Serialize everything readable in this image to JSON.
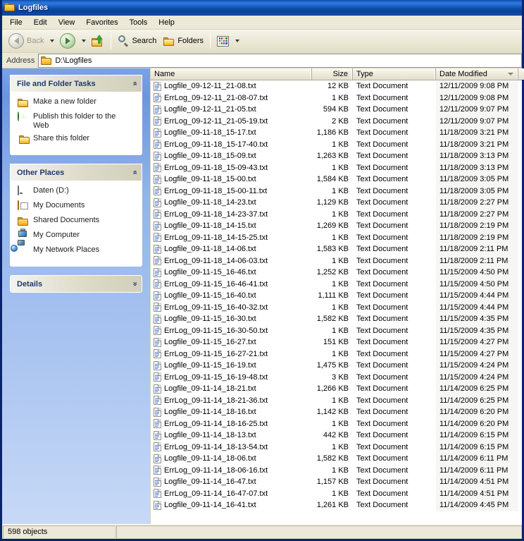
{
  "window": {
    "title": "Logfiles",
    "title_icon": "folder-icon"
  },
  "menubar": {
    "items": [
      {
        "label": "File"
      },
      {
        "label": "Edit"
      },
      {
        "label": "View"
      },
      {
        "label": "Favorites"
      },
      {
        "label": "Tools"
      },
      {
        "label": "Help"
      }
    ]
  },
  "toolbar": {
    "back_label": "Back",
    "back_icon": "arrow-left-icon",
    "back_dropdown_icon": "chevron-down-icon",
    "forward_icon": "arrow-right-icon",
    "forward_dropdown_icon": "chevron-down-icon",
    "up_icon": "up-folder-icon",
    "search_label": "Search",
    "search_icon": "magnifier-icon",
    "folders_label": "Folders",
    "folders_icon": "folder-open-icon",
    "views_icon": "views-icon",
    "views_dropdown_icon": "chevron-down-icon"
  },
  "address": {
    "label": "Address",
    "icon": "folder-icon",
    "value": "D:\\Logfiles"
  },
  "sidebar": {
    "panels": [
      {
        "title": "File and Folder Tasks",
        "chevron": "«",
        "chevron_state": "expanded",
        "links": [
          {
            "label": "Make a new folder",
            "icon": "new-folder-icon"
          },
          {
            "label": "Publish this folder to the Web",
            "icon": "publish-web-icon"
          },
          {
            "label": "Share this folder",
            "icon": "share-folder-icon"
          }
        ]
      },
      {
        "title": "Other Places",
        "chevron": "«",
        "chevron_state": "expanded",
        "links": [
          {
            "label": "Daten (D:)",
            "icon": "drive-icon"
          },
          {
            "label": "My Documents",
            "icon": "my-documents-icon"
          },
          {
            "label": "Shared Documents",
            "icon": "shared-documents-icon"
          },
          {
            "label": "My Computer",
            "icon": "my-computer-icon"
          },
          {
            "label": "My Network Places",
            "icon": "network-places-icon"
          }
        ]
      },
      {
        "title": "Details",
        "chevron": "»",
        "chevron_state": "collapsed",
        "links": []
      }
    ]
  },
  "filelist": {
    "columns": [
      {
        "key": "name",
        "label": "Name"
      },
      {
        "key": "size",
        "label": "Size"
      },
      {
        "key": "type",
        "label": "Type"
      },
      {
        "key": "date",
        "label": "Date Modified"
      }
    ],
    "sort_column": "Date Modified",
    "sort_direction": "descending",
    "sort_icon": "sort-descending-icon",
    "row_icon": "text-document-icon",
    "rows": [
      {
        "name": "Logfile_09-12-11_21-08.txt",
        "size": "12 KB",
        "type": "Text Document",
        "date": "12/11/2009 9:08 PM"
      },
      {
        "name": "ErrLog_09-12-11_21-08-07.txt",
        "size": "1 KB",
        "type": "Text Document",
        "date": "12/11/2009 9:08 PM"
      },
      {
        "name": "Logfile_09-12-11_21-05.txt",
        "size": "594 KB",
        "type": "Text Document",
        "date": "12/11/2009 9:07 PM"
      },
      {
        "name": "ErrLog_09-12-11_21-05-19.txt",
        "size": "2 KB",
        "type": "Text Document",
        "date": "12/11/2009 9:07 PM"
      },
      {
        "name": "Logfile_09-11-18_15-17.txt",
        "size": "1,186 KB",
        "type": "Text Document",
        "date": "11/18/2009 3:21 PM"
      },
      {
        "name": "ErrLog_09-11-18_15-17-40.txt",
        "size": "1 KB",
        "type": "Text Document",
        "date": "11/18/2009 3:21 PM"
      },
      {
        "name": "Logfile_09-11-18_15-09.txt",
        "size": "1,263 KB",
        "type": "Text Document",
        "date": "11/18/2009 3:13 PM"
      },
      {
        "name": "ErrLog_09-11-18_15-09-43.txt",
        "size": "1 KB",
        "type": "Text Document",
        "date": "11/18/2009 3:13 PM"
      },
      {
        "name": "Logfile_09-11-18_15-00.txt",
        "size": "1,584 KB",
        "type": "Text Document",
        "date": "11/18/2009 3:05 PM"
      },
      {
        "name": "ErrLog_09-11-18_15-00-11.txt",
        "size": "1 KB",
        "type": "Text Document",
        "date": "11/18/2009 3:05 PM"
      },
      {
        "name": "Logfile_09-11-18_14-23.txt",
        "size": "1,129 KB",
        "type": "Text Document",
        "date": "11/18/2009 2:27 PM"
      },
      {
        "name": "ErrLog_09-11-18_14-23-37.txt",
        "size": "1 KB",
        "type": "Text Document",
        "date": "11/18/2009 2:27 PM"
      },
      {
        "name": "Logfile_09-11-18_14-15.txt",
        "size": "1,269 KB",
        "type": "Text Document",
        "date": "11/18/2009 2:19 PM"
      },
      {
        "name": "ErrLog_09-11-18_14-15-25.txt",
        "size": "1 KB",
        "type": "Text Document",
        "date": "11/18/2009 2:19 PM"
      },
      {
        "name": "Logfile_09-11-18_14-06.txt",
        "size": "1,583 KB",
        "type": "Text Document",
        "date": "11/18/2009 2:11 PM"
      },
      {
        "name": "ErrLog_09-11-18_14-06-03.txt",
        "size": "1 KB",
        "type": "Text Document",
        "date": "11/18/2009 2:11 PM"
      },
      {
        "name": "Logfile_09-11-15_16-46.txt",
        "size": "1,252 KB",
        "type": "Text Document",
        "date": "11/15/2009 4:50 PM"
      },
      {
        "name": "ErrLog_09-11-15_16-46-41.txt",
        "size": "1 KB",
        "type": "Text Document",
        "date": "11/15/2009 4:50 PM"
      },
      {
        "name": "Logfile_09-11-15_16-40.txt",
        "size": "1,111 KB",
        "type": "Text Document",
        "date": "11/15/2009 4:44 PM"
      },
      {
        "name": "ErrLog_09-11-15_16-40-32.txt",
        "size": "1 KB",
        "type": "Text Document",
        "date": "11/15/2009 4:44 PM"
      },
      {
        "name": "Logfile_09-11-15_16-30.txt",
        "size": "1,582 KB",
        "type": "Text Document",
        "date": "11/15/2009 4:35 PM"
      },
      {
        "name": "ErrLog_09-11-15_16-30-50.txt",
        "size": "1 KB",
        "type": "Text Document",
        "date": "11/15/2009 4:35 PM"
      },
      {
        "name": "Logfile_09-11-15_16-27.txt",
        "size": "151 KB",
        "type": "Text Document",
        "date": "11/15/2009 4:27 PM"
      },
      {
        "name": "ErrLog_09-11-15_16-27-21.txt",
        "size": "1 KB",
        "type": "Text Document",
        "date": "11/15/2009 4:27 PM"
      },
      {
        "name": "Logfile_09-11-15_16-19.txt",
        "size": "1,475 KB",
        "type": "Text Document",
        "date": "11/15/2009 4:24 PM"
      },
      {
        "name": "ErrLog_09-11-15_16-19-48.txt",
        "size": "3 KB",
        "type": "Text Document",
        "date": "11/15/2009 4:24 PM"
      },
      {
        "name": "Logfile_09-11-14_18-21.txt",
        "size": "1,266 KB",
        "type": "Text Document",
        "date": "11/14/2009 6:25 PM"
      },
      {
        "name": "ErrLog_09-11-14_18-21-36.txt",
        "size": "1 KB",
        "type": "Text Document",
        "date": "11/14/2009 6:25 PM"
      },
      {
        "name": "Logfile_09-11-14_18-16.txt",
        "size": "1,142 KB",
        "type": "Text Document",
        "date": "11/14/2009 6:20 PM"
      },
      {
        "name": "ErrLog_09-11-14_18-16-25.txt",
        "size": "1 KB",
        "type": "Text Document",
        "date": "11/14/2009 6:20 PM"
      },
      {
        "name": "Logfile_09-11-14_18-13.txt",
        "size": "442 KB",
        "type": "Text Document",
        "date": "11/14/2009 6:15 PM"
      },
      {
        "name": "ErrLog_09-11-14_18-13-54.txt",
        "size": "1 KB",
        "type": "Text Document",
        "date": "11/14/2009 6:15 PM"
      },
      {
        "name": "Logfile_09-11-14_18-06.txt",
        "size": "1,582 KB",
        "type": "Text Document",
        "date": "11/14/2009 6:11 PM"
      },
      {
        "name": "ErrLog_09-11-14_18-06-16.txt",
        "size": "1 KB",
        "type": "Text Document",
        "date": "11/14/2009 6:11 PM"
      },
      {
        "name": "Logfile_09-11-14_16-47.txt",
        "size": "1,157 KB",
        "type": "Text Document",
        "date": "11/14/2009 4:51 PM"
      },
      {
        "name": "ErrLog_09-11-14_16-47-07.txt",
        "size": "1 KB",
        "type": "Text Document",
        "date": "11/14/2009 4:51 PM"
      },
      {
        "name": "Logfile_09-11-14_16-41.txt",
        "size": "1,261 KB",
        "type": "Text Document",
        "date": "11/14/2009 4:45 PM"
      }
    ]
  },
  "statusbar": {
    "object_count": "598 objects"
  },
  "colors": {
    "titlebar_blue": "#1b60c4",
    "sidebar_blue": "#b6cbf0",
    "chrome_beige": "#ece9d8",
    "panel_header": "#d9d6c3",
    "panel_title_text": "#1f3a6e",
    "sorted_column_tint": "#f6f6f4"
  }
}
